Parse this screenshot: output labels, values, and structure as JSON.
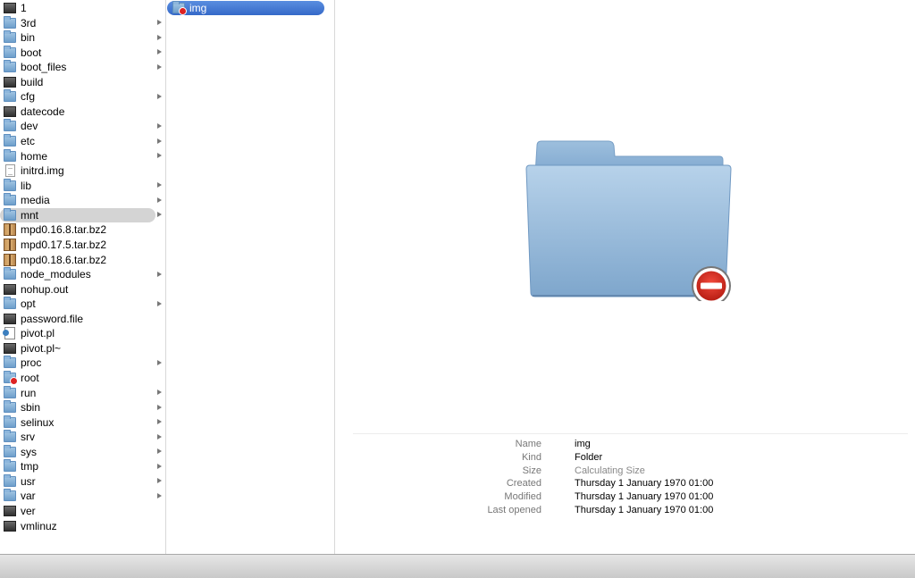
{
  "column1": {
    "items": [
      {
        "label": "1",
        "icon": "exec",
        "arrow": false
      },
      {
        "label": "3rd",
        "icon": "folder",
        "arrow": true
      },
      {
        "label": "bin",
        "icon": "folder",
        "arrow": true
      },
      {
        "label": "boot",
        "icon": "folder",
        "arrow": true
      },
      {
        "label": "boot_files",
        "icon": "folder",
        "arrow": true
      },
      {
        "label": "build",
        "icon": "exec",
        "arrow": false
      },
      {
        "label": "cfg",
        "icon": "folder",
        "arrow": true
      },
      {
        "label": "datecode",
        "icon": "exec",
        "arrow": false
      },
      {
        "label": "dev",
        "icon": "folder",
        "arrow": true
      },
      {
        "label": "etc",
        "icon": "folder",
        "arrow": true
      },
      {
        "label": "home",
        "icon": "folder",
        "arrow": true
      },
      {
        "label": "initrd.img",
        "icon": "doc",
        "arrow": false
      },
      {
        "label": "lib",
        "icon": "folder",
        "arrow": true
      },
      {
        "label": "media",
        "icon": "folder",
        "arrow": true
      },
      {
        "label": "mnt",
        "icon": "folder",
        "arrow": true,
        "selected": true
      },
      {
        "label": "mpd0.16.8.tar.bz2",
        "icon": "archive",
        "arrow": false
      },
      {
        "label": "mpd0.17.5.tar.bz2",
        "icon": "archive",
        "arrow": false
      },
      {
        "label": "mpd0.18.6.tar.bz2",
        "icon": "archive",
        "arrow": false
      },
      {
        "label": "node_modules",
        "icon": "folder",
        "arrow": true
      },
      {
        "label": "nohup.out",
        "icon": "exec",
        "arrow": false
      },
      {
        "label": "opt",
        "icon": "folder",
        "arrow": true
      },
      {
        "label": "password.file",
        "icon": "exec",
        "arrow": false
      },
      {
        "label": "pivot.pl",
        "icon": "script",
        "arrow": false
      },
      {
        "label": "pivot.pl~",
        "icon": "exec",
        "arrow": false
      },
      {
        "label": "proc",
        "icon": "folder",
        "arrow": true
      },
      {
        "label": "root",
        "icon": "rootfolder",
        "arrow": false
      },
      {
        "label": "run",
        "icon": "folder",
        "arrow": true
      },
      {
        "label": "sbin",
        "icon": "folder",
        "arrow": true
      },
      {
        "label": "selinux",
        "icon": "folder",
        "arrow": true
      },
      {
        "label": "srv",
        "icon": "folder",
        "arrow": true
      },
      {
        "label": "sys",
        "icon": "folder",
        "arrow": true
      },
      {
        "label": "tmp",
        "icon": "folder",
        "arrow": true
      },
      {
        "label": "usr",
        "icon": "folder",
        "arrow": true
      },
      {
        "label": "var",
        "icon": "folder",
        "arrow": true
      },
      {
        "label": "ver",
        "icon": "exec",
        "arrow": false
      },
      {
        "label": "vmlinuz",
        "icon": "exec",
        "arrow": false
      }
    ]
  },
  "column2": {
    "items": [
      {
        "label": "img",
        "icon": "rootfolder",
        "selected": true
      }
    ]
  },
  "preview": {
    "icon": "folder-no-access-icon",
    "info": [
      {
        "key": "Name",
        "value": "img"
      },
      {
        "key": "Kind",
        "value": "Folder"
      },
      {
        "key": "Size",
        "value": "Calculating Size",
        "muted": true
      },
      {
        "key": "Created",
        "value": "Thursday 1 January 1970 01:00"
      },
      {
        "key": "Modified",
        "value": "Thursday 1 January 1970 01:00"
      },
      {
        "key": "Last opened",
        "value": "Thursday 1 January 1970 01:00"
      }
    ]
  },
  "colors": {
    "selection_blue": "#3569c8",
    "selection_gray": "#d4d4d4",
    "folder_blue": "#8db6dc"
  }
}
